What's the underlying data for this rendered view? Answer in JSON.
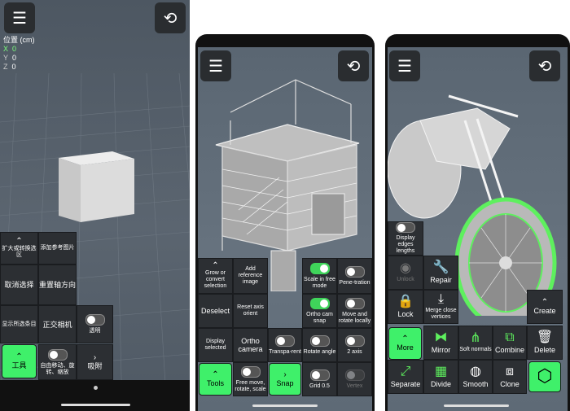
{
  "panel1": {
    "coords": {
      "title": "位置 (cm)",
      "x_label": "X",
      "x_value": "0",
      "y_label": "Y",
      "y_value": "0",
      "z_label": "Z",
      "z_value": "0"
    },
    "menu": {
      "expand": "扩大或转换选区",
      "add_ref": "添加参考图片",
      "deselect": "取消选择",
      "reset_axis": "重置轴方向",
      "show_selected": "显示所选条目",
      "ortho": "正交相机",
      "transparent": "透明",
      "tools": "工具",
      "free_move": "自由移动、旋转、缩放",
      "snap": "吸附"
    }
  },
  "panel2": {
    "grow": "Grow or convert selection",
    "add_ref": "Add reference image",
    "scale_free": "Scale in free mode",
    "penetration": "Pene-tration",
    "deselect": "Deselect",
    "reset_axis": "Reset axis orient",
    "ortho_snap": "Ortho cam snap",
    "move_rotate_local": "Move and rotate locally",
    "display_selected": "Display selected",
    "ortho_camera": "Ortho camera",
    "transparent": "Transpa-rent",
    "rotate_angle": "Rotate angle",
    "axis2": "2 axis",
    "tools": "Tools",
    "free_move": "Free move, rotate, scale",
    "snap": "Snap",
    "grid": "Grid 0.5",
    "vertex": "Vertex"
  },
  "panel3": {
    "display_edges": "Display edges lengths",
    "unlock": "Unlock",
    "repair": "Repair",
    "lock": "Lock",
    "merge_close": "Merge close vertices",
    "create": "Create",
    "more": "More",
    "mirror": "Mirror",
    "soft_normals": "Soft normals",
    "combine": "Combine",
    "delete": "Delete",
    "separate": "Separate",
    "divide": "Divide",
    "smooth": "Smooth",
    "clone": "Clone"
  }
}
